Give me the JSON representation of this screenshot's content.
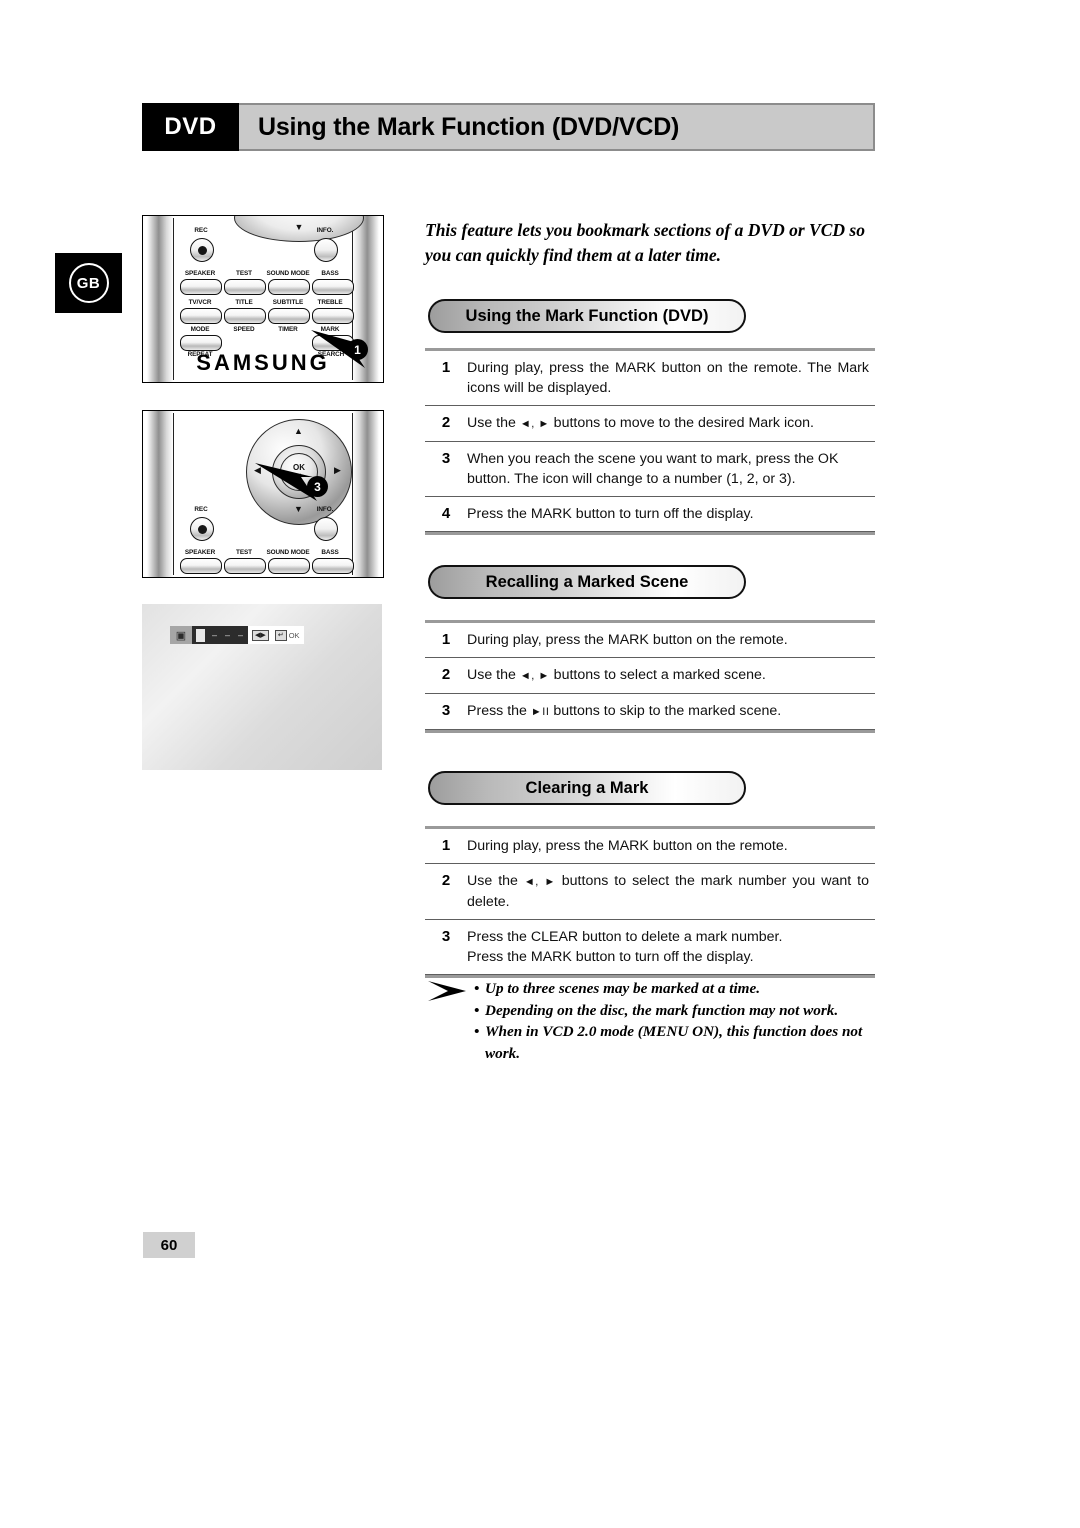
{
  "header": {
    "tag": "DVD",
    "title": "Using the Mark Function (DVD/VCD)"
  },
  "region_badge": {
    "label": "GB"
  },
  "intro": "This feature lets you bookmark sections of a DVD or VCD so you can quickly find them at a later time.",
  "sections": [
    {
      "pill": "Using the Mark Function (DVD)",
      "steps": [
        {
          "num": "1",
          "text": "During play, press the MARK button on the remote. The Mark icons will be displayed."
        },
        {
          "num": "2",
          "text_before": "Use the ",
          "icons": "◄, ►",
          "text_after": " buttons to move to the desired Mark icon."
        },
        {
          "num": "3",
          "text": "When you reach the scene you want to mark, press the OK button. The icon will change to a number (1, 2, or 3)."
        },
        {
          "num": "4",
          "text": "Press the MARK button to turn off the display."
        }
      ]
    },
    {
      "pill": "Recalling a Marked Scene",
      "steps": [
        {
          "num": "1",
          "text": "During play, press the MARK button on the remote."
        },
        {
          "num": "2",
          "text_before": "Use the ",
          "icons": "◄, ►",
          "text_after": " buttons to select a marked scene."
        },
        {
          "num": "3",
          "text_before": "Press the ",
          "icons": "►II",
          "text_after": " buttons to skip to the marked scene."
        }
      ]
    },
    {
      "pill": "Clearing a Mark",
      "steps": [
        {
          "num": "1",
          "text": "During play, press the MARK button on the remote."
        },
        {
          "num": "2",
          "text_before": "Use the ",
          "icons": "◄, ►",
          "text_after": " buttons to select the mark number you want to delete."
        },
        {
          "num": "3",
          "text": "Press the CLEAR button to delete a mark number.\nPress the MARK button to turn off the display."
        }
      ]
    }
  ],
  "notes": [
    "Up to three scenes may be marked at a time.",
    "Depending on the disc, the mark function may not work.",
    "When in VCD 2.0 mode (MENU ON), this function does not work."
  ],
  "illustrations": {
    "remote_top": {
      "callout": "1",
      "brand": "SAMSUNG",
      "buttons": [
        "REC",
        "INFO.",
        "SPEAKER",
        "TEST",
        "SOUND MODE",
        "BASS",
        "TV/VCR",
        "TITLE",
        "SUBTITLE",
        "TREBLE",
        "MODE",
        "SPEED",
        "TIMER",
        "MARK",
        "REPEAT",
        "SEARCH"
      ]
    },
    "remote_bottom": {
      "callout": "3",
      "ok_label": "OK",
      "buttons": [
        "REC",
        "INFO.",
        "SPEAKER",
        "TEST",
        "SOUND MODE",
        "BASS"
      ]
    },
    "tv_osd": {
      "ok_label": "OK"
    }
  },
  "page_number": "60"
}
